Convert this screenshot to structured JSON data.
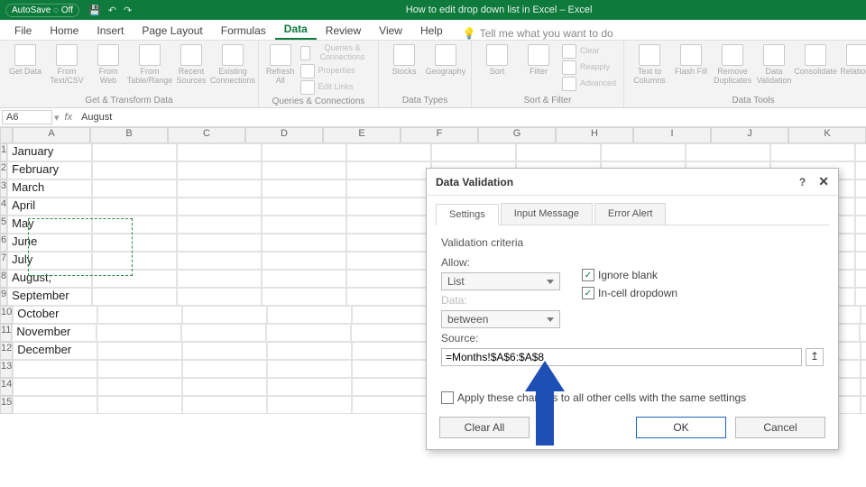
{
  "titlebar": {
    "autosave": "AutoSave ◌ Off",
    "window_title": "How to edit drop down list in Excel  –  Excel",
    "qat": [
      "💾",
      "↶",
      "↷"
    ]
  },
  "menu": {
    "tabs": [
      "File",
      "Home",
      "Insert",
      "Page Layout",
      "Formulas",
      "Data",
      "Review",
      "View",
      "Help"
    ],
    "active": "Data",
    "tellme": "Tell me what you want to do",
    "tell_icon": "💡"
  },
  "ribbon": {
    "g1": {
      "label": "Get & Transform Data",
      "b1": "Get Data",
      "b2": "From Text/CSV",
      "b3": "From Web",
      "b4": "From Table/Range",
      "b5": "Recent Sources",
      "b6": "Existing Connections"
    },
    "g2": {
      "label": "Queries & Connections",
      "b1": "Refresh All",
      "l1": "Queries & Connections",
      "l2": "Properties",
      "l3": "Edit Links"
    },
    "g3": {
      "label": "Data Types",
      "b1": "Stocks",
      "b2": "Geography"
    },
    "g4": {
      "label": "Sort & Filter",
      "sort": "Sort",
      "filter": "Filter",
      "clear": "Clear",
      "reapply": "Reapply",
      "adv": "Advanced"
    },
    "g5": {
      "label": "Data Tools",
      "b1": "Text to Columns",
      "b2": "Flash Fill",
      "b3": "Remove Duplicates",
      "b4": "Data Validation",
      "b5": "Consolidate",
      "b6": "Relations"
    }
  },
  "formula_bar": {
    "namebox": "A6",
    "value": "August"
  },
  "columns": [
    "A",
    "B",
    "C",
    "D",
    "E",
    "F",
    "G",
    "H",
    "I",
    "J",
    "K"
  ],
  "rows": [
    "1",
    "2",
    "3",
    "4",
    "5",
    "6",
    "7",
    "8",
    "9",
    "10",
    "11",
    "12",
    "13",
    "14",
    "15"
  ],
  "cells": {
    "A": [
      "January",
      "February",
      "March",
      "April",
      "May",
      "June",
      "July",
      "August;",
      "September",
      "October",
      "November",
      "December",
      "",
      "",
      ""
    ]
  },
  "dialog": {
    "title": "Data Validation",
    "help": "?",
    "close": "✕",
    "tabs": {
      "t1": "Settings",
      "t2": "Input Message",
      "t3": "Error Alert"
    },
    "criteria": "Validation criteria",
    "allow_lbl": "Allow:",
    "allow_val": "List",
    "data_lbl": "Data:",
    "data_val": "between",
    "ignore": "Ignore blank",
    "incell": "In-cell dropdown",
    "source_lbl": "Source:",
    "source_val": "=Months!$A$6:$A$8",
    "apply": "Apply these changes to all other cells with the same settings",
    "clear": "Clear All",
    "ok": "OK",
    "cancel": "Cancel",
    "picker": "↥"
  }
}
